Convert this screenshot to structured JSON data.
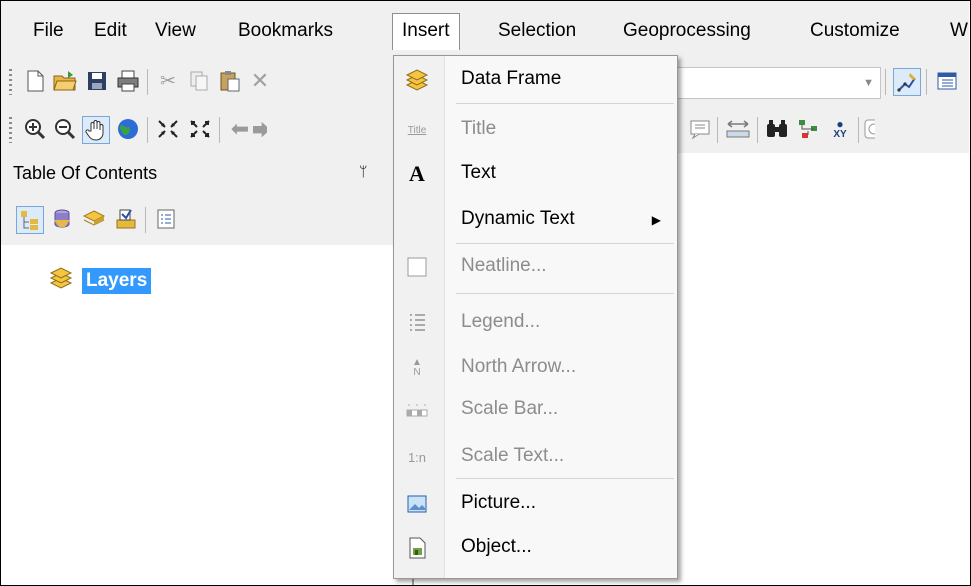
{
  "menubar": {
    "items": [
      "File",
      "Edit",
      "View",
      "Bookmarks",
      "Insert",
      "Selection",
      "Geoprocessing",
      "Customize",
      "W"
    ]
  },
  "toolbar1": {
    "icons": [
      "new-document-icon",
      "open-folder-icon",
      "save-icon",
      "print-icon",
      "cut-icon",
      "copy-icon",
      "paste-icon",
      "delete-icon"
    ],
    "right_icons": [
      "editor-icon",
      "table-window-icon"
    ],
    "combo_value": ""
  },
  "toolbar2": {
    "icons": [
      "zoom-in-icon",
      "zoom-out-icon",
      "pan-hand-icon",
      "full-extent-globe-icon",
      "fixed-zoom-in-icon",
      "fixed-zoom-out-icon",
      "back-arrow-icon",
      "forward-arrow-icon"
    ],
    "right_icons": [
      "html-popup-icon",
      "measure-icon",
      "find-binoculars-icon",
      "find-route-icon",
      "go-to-xy-icon",
      "time-slider-icon"
    ],
    "xy_label": "XY"
  },
  "toc": {
    "title": "Table Of Contents",
    "pin": "ᛘ",
    "tools": [
      "list-by-drawing-order-icon",
      "list-by-source-icon",
      "list-by-visibility-icon",
      "list-by-selection-icon",
      "options-icon"
    ],
    "layer_label": "Layers"
  },
  "insert_menu": {
    "items": [
      {
        "label": "Data Frame",
        "icon": "data-frame-icon",
        "enabled": true
      },
      {
        "label": "Title",
        "icon": "title-icon",
        "icon_text": "Title",
        "enabled": false
      },
      {
        "label": "Text",
        "icon": "text-icon",
        "icon_text": "A",
        "enabled": true
      },
      {
        "label": "Dynamic Text",
        "icon": "",
        "enabled": true,
        "submenu": true
      },
      {
        "label": "Neatline...",
        "icon": "neatline-icon",
        "enabled": false
      },
      {
        "label": "Legend...",
        "icon": "legend-icon",
        "enabled": false
      },
      {
        "label": "North Arrow...",
        "icon": "north-arrow-icon",
        "icon_text": "N",
        "enabled": false
      },
      {
        "label": "Scale Bar...",
        "icon": "scale-bar-icon",
        "enabled": false
      },
      {
        "label": "Scale Text...",
        "icon": "scale-text-icon",
        "icon_text": "1:n",
        "enabled": false
      },
      {
        "label": "Picture...",
        "icon": "picture-icon",
        "enabled": true
      },
      {
        "label": "Object...",
        "icon": "object-icon",
        "enabled": true
      }
    ]
  },
  "colors": {
    "selection": "#3399ff",
    "menu_bg": "#f8f8f8",
    "disabled_text": "#8c8c8c"
  }
}
